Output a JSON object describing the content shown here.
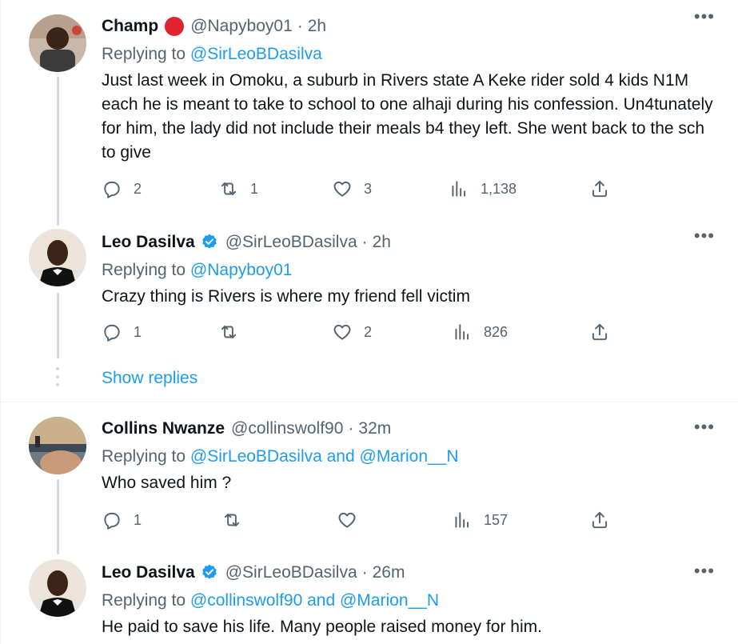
{
  "tweets": [
    {
      "name": "Champ",
      "handle": "@Napyboy01",
      "time": "2h",
      "replying_prefix": "Replying to",
      "replying_to": "@SirLeoBDasilva",
      "text": "Just last week in Omoku, a suburb in Rivers state A Keke rider sold 4 kids N1M each he is meant to take to school to one alhaji during his confession. Un4tunately for him, the lady did not include their meals b4 they left. She went back to the sch to give",
      "replies": "2",
      "retweets": "1",
      "likes": "3",
      "views": "1,138"
    },
    {
      "name": "Leo Dasilva",
      "handle": "@SirLeoBDasilva",
      "time": "2h",
      "replying_prefix": "Replying to",
      "replying_to": "@Napyboy01",
      "text": "Crazy thing is Rivers is where my friend fell victim",
      "replies": "1",
      "retweets": "",
      "likes": "2",
      "views": "826"
    },
    {
      "name": "Collins Nwanze",
      "handle": "@collinswolf90",
      "time": "32m",
      "replying_prefix": "Replying to",
      "replying_to": "@SirLeoBDasilva and @Marion__N",
      "text": "Who saved him ?",
      "replies": "1",
      "retweets": "",
      "likes": "",
      "views": "157"
    },
    {
      "name": "Leo Dasilva",
      "handle": "@SirLeoBDasilva",
      "time": "26m",
      "replying_prefix": "Replying to",
      "replying_to": "@collinswolf90 and @Marion__N",
      "text": "He paid to save his life. Many people raised money for him."
    }
  ],
  "show_replies": "Show replies",
  "separator": "·",
  "more": "•••",
  "colors": {
    "accent": "#1d9bf0",
    "secondary": "#536471",
    "badge": "#e0242f"
  }
}
